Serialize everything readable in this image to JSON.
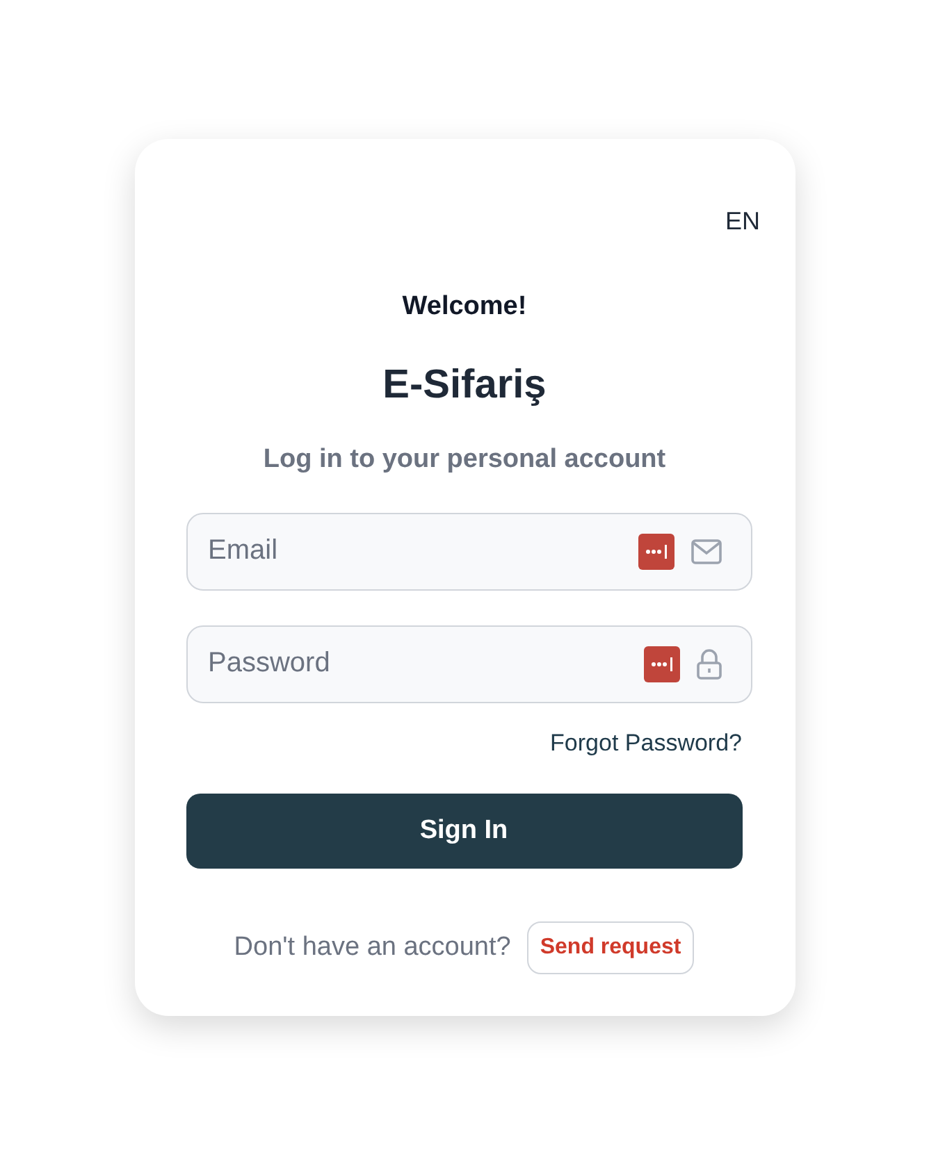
{
  "language": "EN",
  "greeting": "Welcome!",
  "app_name": "E-Sifariş",
  "subtitle": "Log in to your personal account",
  "fields": [
    {
      "kind": "email",
      "placeholder": "Email"
    },
    {
      "kind": "password",
      "placeholder": "Password"
    }
  ],
  "forgot_link": "Forgot Password?",
  "submit_button": "Sign In",
  "footer": {
    "prompt": "Don't have an account?",
    "link": "Send request"
  }
}
